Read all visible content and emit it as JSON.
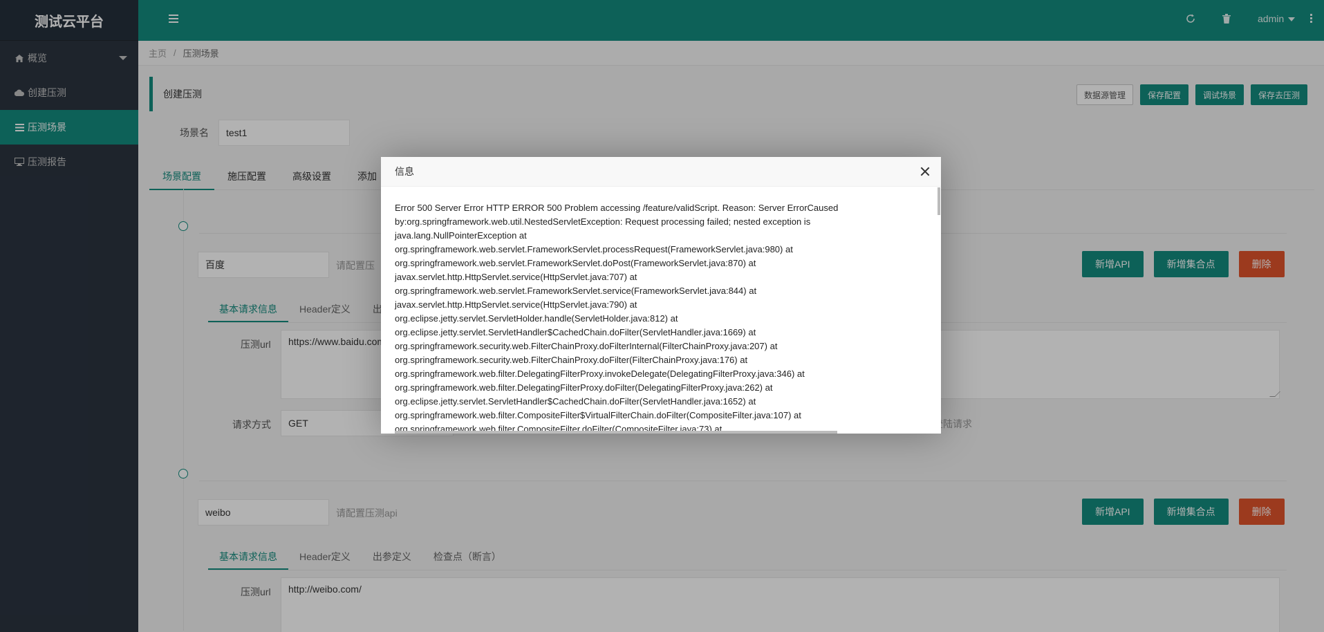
{
  "app": {
    "name": "测试云平台"
  },
  "sidebar": {
    "items": [
      {
        "label": "概览",
        "icon": "home-icon"
      },
      {
        "label": "创建压测",
        "icon": "cloud-icon"
      },
      {
        "label": "压测场景",
        "icon": "list-icon"
      },
      {
        "label": "压测报告",
        "icon": "monitor-icon"
      }
    ],
    "active_index": 2
  },
  "header": {
    "user": "admin"
  },
  "breadcrumb": {
    "home": "主页",
    "sep": "/",
    "current": "压测场景"
  },
  "page": {
    "title": "创建压测",
    "buttons": {
      "datasource": "数据源管理",
      "save_config": "保存配置",
      "debug": "调试场景",
      "save_run": "保存去压测"
    },
    "scene_label": "场景名",
    "scene_name": "test1",
    "tabs": [
      "场景配置",
      "施压配置",
      "高级设置",
      "添加"
    ]
  },
  "apis": [
    {
      "name": "百度",
      "hint": "请配置压",
      "subtabs": [
        "基本请求信息",
        "Header定义",
        "出"
      ],
      "url_label": "压测url",
      "url": "https://www.baidu.com",
      "method_label": "请求方式",
      "method": "GET",
      "login_hint": "登陆请求"
    },
    {
      "name": "weibo",
      "hint": "请配置压测api",
      "subtabs": [
        "基本请求信息",
        "Header定义",
        "出参定义",
        "检查点（断言）"
      ],
      "url_label": "压测url",
      "url": "http://weibo.com/"
    }
  ],
  "api_buttons": {
    "add_api": "新增API",
    "add_rendezvous": "新增集合点",
    "delete": "删除"
  },
  "modal": {
    "title": "信息",
    "lines": [
      "Error 500 Server Error HTTP ERROR 500 Problem accessing /feature/validScript. Reason: Server ErrorCaused by:org.springframework.web.util.NestedServletException: Request processing failed; nested exception is java.lang.NullPointerException at",
      "org.springframework.web.servlet.FrameworkServlet.processRequest(FrameworkServlet.java:980) at",
      "org.springframework.web.servlet.FrameworkServlet.doPost(FrameworkServlet.java:870) at",
      "javax.servlet.http.HttpServlet.service(HttpServlet.java:707) at",
      "org.springframework.web.servlet.FrameworkServlet.service(FrameworkServlet.java:844) at",
      "javax.servlet.http.HttpServlet.service(HttpServlet.java:790) at",
      "org.eclipse.jetty.servlet.ServletHolder.handle(ServletHolder.java:812) at",
      "org.eclipse.jetty.servlet.ServletHandler$CachedChain.doFilter(ServletHandler.java:1669) at",
      "org.springframework.security.web.FilterChainProxy.doFilterInternal(FilterChainProxy.java:207) at",
      "org.springframework.security.web.FilterChainProxy.doFilter(FilterChainProxy.java:176) at",
      "org.springframework.web.filter.DelegatingFilterProxy.invokeDelegate(DelegatingFilterProxy.java:346) at",
      "org.springframework.web.filter.DelegatingFilterProxy.doFilter(DelegatingFilterProxy.java:262) at",
      "org.eclipse.jetty.servlet.ServletHandler$CachedChain.doFilter(ServletHandler.java:1652) at",
      "org.springframework.web.filter.CompositeFilter$VirtualFilterChain.doFilter(CompositeFilter.java:107) at",
      "org.springframework.web.filter.CompositeFilter.doFilter(CompositeFilter.java:73) at"
    ]
  },
  "colors": {
    "primary": "#148b7e",
    "sidebar": "#2b3440",
    "danger": "#e0532b"
  }
}
